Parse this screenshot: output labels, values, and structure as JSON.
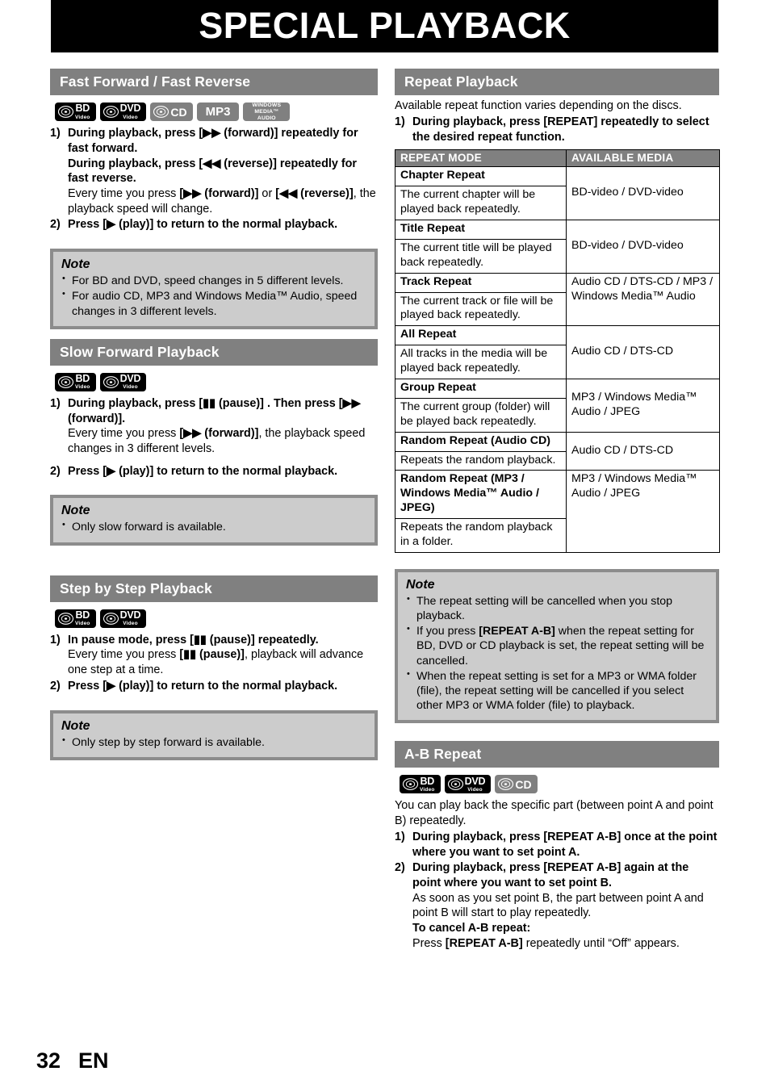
{
  "page": {
    "title": "SPECIAL PLAYBACK",
    "number": "32",
    "language": "EN"
  },
  "icons": {
    "bd": {
      "main": "BD",
      "sub": "Video"
    },
    "dvd": {
      "main": "DVD",
      "sub": "Video"
    },
    "cd": {
      "main": "CD"
    },
    "mp3": {
      "main": "MP3"
    },
    "wma": {
      "line1": "WINDOWS",
      "line2": "MEDIA™",
      "line3": "AUDIO"
    }
  },
  "left": {
    "ff_fr": {
      "heading": "Fast Forward / Fast Reverse",
      "steps": [
        {
          "num": "1)",
          "bold1": "During playback, press [▶▶ (forward)] repeatedly for fast forward.",
          "bold2": "During playback, press [◀◀ (reverse)] repeatedly for fast reverse.",
          "plain_pre": "Every time you press ",
          "plain_b1": "[▶▶ (forward)]",
          "plain_mid": " or ",
          "plain_b2": "[◀◀ (reverse)]",
          "plain_post": ", the playback speed will change."
        },
        {
          "num": "2)",
          "bold1": "Press [▶ (play)] to return to the normal playback."
        }
      ],
      "note": {
        "title": "Note",
        "items": [
          "For BD and DVD, speed changes in 5 different levels.",
          "For audio CD, MP3 and Windows Media™ Audio, speed changes in 3 different levels."
        ]
      }
    },
    "slow_forward": {
      "heading": "Slow Forward Playback",
      "steps": [
        {
          "num": "1)",
          "bold1": "During playback, press [▮▮ (pause)] . Then press [▶▶ (forward)].",
          "plain_pre": "Every time you press ",
          "plain_b1": "[▶▶ (forward)]",
          "plain_post": ", the playback speed changes in 3 different levels."
        },
        {
          "num": "2)",
          "bold1": "Press [▶ (play)] to return to the normal playback."
        }
      ],
      "note": {
        "title": "Note",
        "items": [
          "Only slow forward is available."
        ]
      }
    },
    "step_by_step": {
      "heading": "Step by Step Playback",
      "steps": [
        {
          "num": "1)",
          "bold1": "In pause mode, press [▮▮ (pause)] repeatedly.",
          "plain_pre": "Every time you press ",
          "plain_b1": "[▮▮ (pause)]",
          "plain_post": ", playback will advance one step at a time."
        },
        {
          "num": "2)",
          "bold1": "Press [▶ (play)] to return to the normal playback."
        }
      ],
      "note": {
        "title": "Note",
        "items": [
          "Only step by step forward is available."
        ]
      }
    }
  },
  "right": {
    "repeat_playback": {
      "heading": "Repeat Playback",
      "intro": "Available repeat function varies depending on the discs.",
      "step1_num": "1)",
      "step1_text": "During playback, press [REPEAT] repeatedly to select the desired repeat function.",
      "table": {
        "headers": [
          "REPEAT MODE",
          "AVAILABLE MEDIA"
        ],
        "rows": [
          {
            "mode": "Chapter Repeat",
            "desc": "The current chapter will be played back repeatedly.",
            "media": "BD-video / DVD-video"
          },
          {
            "mode": "Title Repeat",
            "desc": "The current title will be played back repeatedly.",
            "media": "BD-video / DVD-video"
          },
          {
            "mode": "Track Repeat",
            "desc": "The current track or file will be played back repeatedly.",
            "media": "Audio CD / DTS-CD / MP3 / Windows Media™ Audio"
          },
          {
            "mode": "All Repeat",
            "desc": "All tracks in the media will be played back repeatedly.",
            "media": "Audio CD / DTS-CD"
          },
          {
            "mode": "Group Repeat",
            "desc": "The current group (folder) will be played back repeatedly.",
            "media": "MP3 / Windows Media™ Audio / JPEG"
          },
          {
            "mode": "Random Repeat (Audio CD)",
            "desc": "Repeats the random playback.",
            "media": "Audio CD / DTS-CD"
          },
          {
            "mode": "Random Repeat (MP3 / Windows Media™ Audio / JPEG)",
            "desc": "Repeats the random playback in a folder.",
            "media": "MP3 / Windows Media™ Audio / JPEG"
          }
        ]
      },
      "note": {
        "title": "Note",
        "items": [
          {
            "pre": "The repeat setting will be cancelled when you stop playback.",
            "bold": "",
            "post": ""
          },
          {
            "pre": "If you press ",
            "bold": "[REPEAT A-B]",
            "post": " when the repeat setting for BD, DVD or CD playback is set, the repeat setting will be cancelled."
          },
          {
            "pre": "When the repeat setting is set for a MP3 or WMA folder (file), the repeat setting will be cancelled if you select other MP3 or WMA folder (file) to playback.",
            "bold": "",
            "post": ""
          }
        ]
      }
    },
    "ab_repeat": {
      "heading": "A-B Repeat",
      "intro": "You can play back the specific part (between point A and point B) repeatedly.",
      "steps": [
        {
          "num": "1)",
          "bold1": "During playback, press [REPEAT A-B] once at the point where you want to set point A."
        },
        {
          "num": "2)",
          "bold1": "During playback, press [REPEAT A-B] again at the point where you want to set point B.",
          "plain_post": "As soon as you set point B, the part between point A and point B will start to play repeatedly.",
          "sub_bold": "To cancel A-B repeat:",
          "sub_pre": "Press ",
          "sub_b": "[REPEAT A-B]",
          "sub_post": " repeatedly until “Off” appears."
        }
      ]
    }
  }
}
